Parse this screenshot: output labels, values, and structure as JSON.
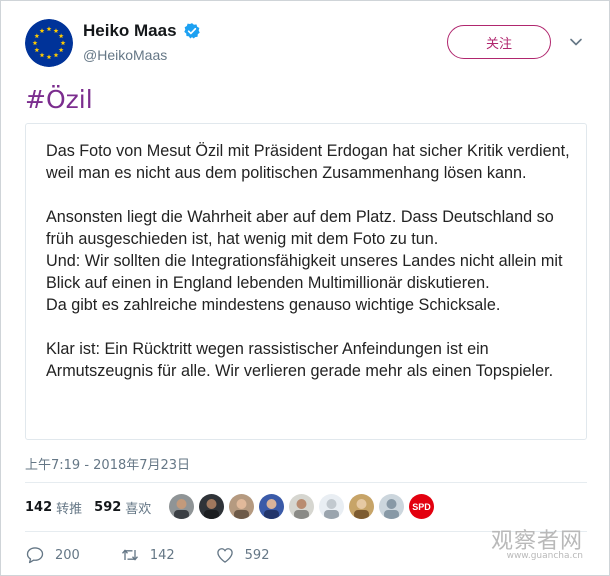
{
  "author": {
    "display_name": "Heiko Maas",
    "handle": "@HeikoMaas",
    "verified": true,
    "avatar": "eu-flag-avatar"
  },
  "follow_button": {
    "label": "关注"
  },
  "menu": {
    "icon": "chevron-down-icon"
  },
  "tweet": {
    "hashtag": "#Özil",
    "card_paragraphs": [
      "Das Foto von Mesut Özil mit Präsident Erdogan hat sicher Kritik verdient, weil man es nicht aus dem politischen Zusammenhang lösen kann.",
      "Ansonsten liegt die Wahrheit aber auf dem Platz. Dass Deutschland so früh ausgeschieden ist, hat wenig mit dem Foto zu tun.\nUnd: Wir sollten die Integrationsfähigkeit unseres Landes nicht allein mit Blick auf einen in England lebenden Multimillionär diskutieren.\nDa gibt es zahlreiche mindestens genauso wichtige Schicksale.",
      "Klar ist: Ein Rücktritt wegen rassistischer Anfeindungen ist ein Armutszeugnis für alle. Wir verlieren gerade mehr als einen Topspieler."
    ],
    "timestamp": "上午7:19 - 2018年7月23日"
  },
  "stats": {
    "retweets": "142",
    "retweets_label": "转推",
    "likes": "592",
    "likes_label": "喜欢",
    "liker_avatars": [
      "avatar-1",
      "avatar-2",
      "avatar-3",
      "avatar-4",
      "avatar-5",
      "avatar-6",
      "avatar-7",
      "avatar-8",
      "spd-avatar"
    ],
    "spd_text": "SPD"
  },
  "actions": {
    "reply_count": "200",
    "retweet_count": "142",
    "like_count": "592"
  },
  "watermark": {
    "text": "观察者网",
    "url": "www.guancha.cn"
  },
  "colors": {
    "accent": "#b0266e",
    "hashtag": "#7b2d8e",
    "verified": "#1da1f2",
    "muted": "#657786",
    "eu_blue": "#003399",
    "eu_gold": "#ffcc00",
    "spd_red": "#e3000f"
  }
}
